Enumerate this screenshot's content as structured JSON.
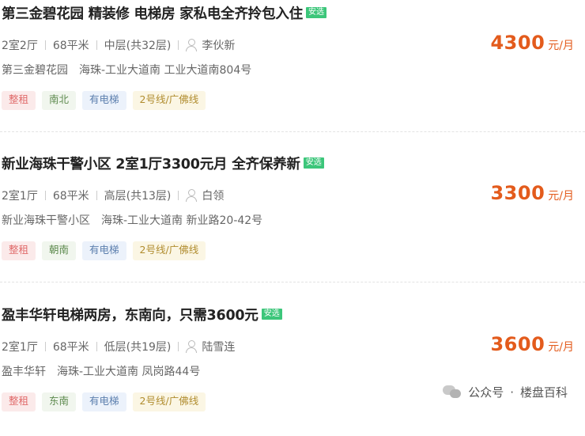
{
  "listings": [
    {
      "title": "第三金碧花园 精装修 电梯房 家私电全齐拎包入住",
      "badge": "安选",
      "layout": "2室2厅",
      "area": "68平米",
      "floor": "中层(共32层)",
      "agent": "李伙新",
      "price": "4300",
      "price_unit": "元/月",
      "community": "第三金碧花园",
      "address": "海珠-工业大道南 工业大道南804号",
      "tags": [
        "整租",
        "南北",
        "有电梯",
        "2号线/广佛线"
      ]
    },
    {
      "title": "新业海珠干警小区 2室1厅3300元月 全齐保养新",
      "badge": "安选",
      "layout": "2室1厅",
      "area": "68平米",
      "floor": "高层(共13层)",
      "agent": "白领",
      "price": "3300",
      "price_unit": "元/月",
      "community": "新业海珠干警小区",
      "address": "海珠-工业大道南 新业路20-42号",
      "tags": [
        "整租",
        "朝南",
        "有电梯",
        "2号线/广佛线"
      ]
    },
    {
      "title": "盈丰华轩电梯两房，东南向，只需3600元",
      "badge": "安选",
      "layout": "2室1厅",
      "area": "68平米",
      "floor": "低层(共19层)",
      "agent": "陆雪连",
      "price": "3600",
      "price_unit": "元/月",
      "community": "盈丰华轩",
      "address": "海珠-工业大道南 凤岗路44号",
      "tags": [
        "整租",
        "东南",
        "有电梯",
        "2号线/广佛线"
      ]
    }
  ],
  "watermark": {
    "account_type": "公众号",
    "dot": "·",
    "name": "楼盘百科"
  },
  "colors": {
    "price": "#e35b1c",
    "badge": "#3cc67a"
  },
  "icons": {
    "agent": "person-icon",
    "watermark": "wechat-icon"
  }
}
